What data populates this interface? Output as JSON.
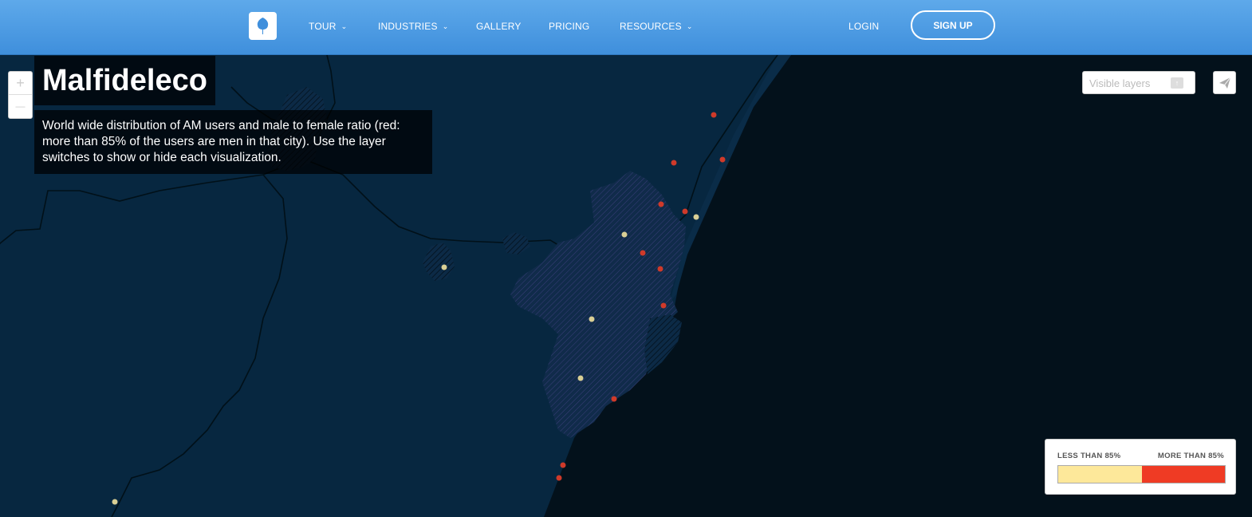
{
  "nav": {
    "items": [
      {
        "label": "TOUR",
        "dropdown": true
      },
      {
        "label": "INDUSTRIES",
        "dropdown": true
      },
      {
        "label": "GALLERY",
        "dropdown": false
      },
      {
        "label": "PRICING",
        "dropdown": false
      },
      {
        "label": "RESOURCES",
        "dropdown": true
      }
    ],
    "login": "LOGIN",
    "signup": "SIGN UP"
  },
  "map": {
    "title": "Malfideleco",
    "description": "World wide distribution of AM users and male to female ratio (red: more than 85% of the users are men in that city). Use the layer switches to show or hide each visualization.",
    "layers_placeholder": "Visible layers",
    "zoom_in": "+",
    "zoom_out": "—",
    "colors": {
      "sea": "#04101a",
      "land": "#072740",
      "low": "#fde89a",
      "high": "#ef3b24",
      "red_dot": "#cf3a2a",
      "yellow_dot": "#d9cf95"
    }
  },
  "legend": {
    "low_label": "LESS THAN 85%",
    "high_label": "MORE THAN 85%",
    "low_color": "#fde89a",
    "high_color": "#ef3b24"
  },
  "icons": {
    "logo": "tree-icon",
    "dropdown": "chevron-down-icon",
    "layers": "layers-toggle-icon",
    "share": "paper-plane-icon"
  }
}
